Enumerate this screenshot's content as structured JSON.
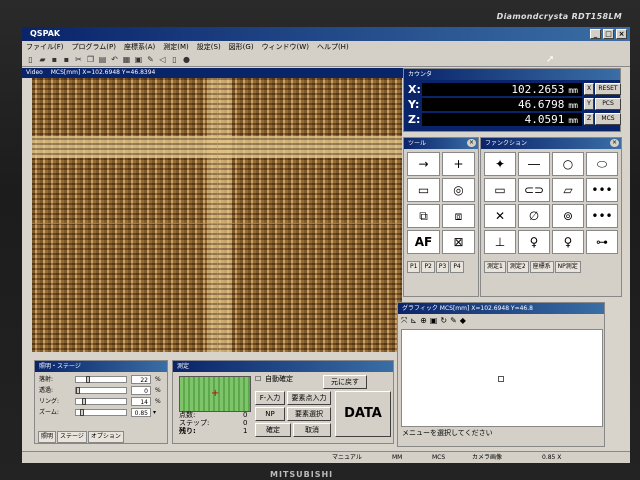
{
  "monitor": {
    "brand": "Diamondcrysta RDT158LM",
    "maker": "MITSUBISHI"
  },
  "app": {
    "title": "QSPAK"
  },
  "window_buttons": [
    "_",
    "□",
    "×"
  ],
  "menu": [
    "ファイル(F)",
    "プログラム(P)",
    "座標系(A)",
    "測定(M)",
    "設定(S)",
    "図形(G)",
    "ウィンドウ(W)",
    "ヘルプ(H)"
  ],
  "video": {
    "label": "Video",
    "coords": "MCS[mm] X=102.6948 Y=46.8394"
  },
  "counter": {
    "title": "カウンタ",
    "x_label": "X:",
    "x_value": "102.2653",
    "x_unit": "mm",
    "y_label": "Y:",
    "y_value": "46.6798",
    "y_unit": "mm",
    "z_label": "Z:",
    "z_value": "4.0591",
    "z_unit": "mm",
    "btn_x": "X",
    "btn_reset": "RESET",
    "btn_y": "Y",
    "btn_pcs": "PCS",
    "btn_z": "Z",
    "btn_mcs": "MCS"
  },
  "tools": {
    "title": "ツール",
    "cells": [
      "→",
      "+",
      "▭",
      "◎",
      "⧉",
      "⧈",
      "AF",
      "⊠"
    ],
    "tabs": [
      "P1",
      "P2",
      "P3",
      "P4"
    ]
  },
  "functions": {
    "title": "ファンクション",
    "cells": [
      "✦",
      "―",
      "○",
      "⬭",
      "▭",
      "⊂⊃",
      "▱",
      "•••",
      "✕",
      "∅",
      "⊚",
      "•••",
      "⊥",
      "♀",
      "♀",
      "⊶"
    ],
    "tabs": [
      "測定1",
      "測定2",
      "座標系",
      "NP測定"
    ]
  },
  "lighting": {
    "title": "照明・ステージ",
    "rows": [
      {
        "label": "落射:",
        "value": "22",
        "unit": "%"
      },
      {
        "label": "透過:",
        "value": "0",
        "unit": "%"
      },
      {
        "label": "リング:",
        "value": "14",
        "unit": "%"
      },
      {
        "label": "ズーム:",
        "value": "0.85",
        "unit": "▾"
      }
    ],
    "tabs": [
      "照明",
      "ステージ",
      "オプション"
    ]
  },
  "measure": {
    "title": "測定",
    "auto_confirm": "自動確定",
    "btn_back": "元に戻す",
    "btn_f": "F-入力",
    "btn_add": "要素点入力",
    "btn_np": "NP",
    "btn_select": "要素選択",
    "btn_data": "DATA",
    "btn_confirm": "確定",
    "btn_cancel": "取消",
    "points_label": "点数:",
    "points_value": "0",
    "step_label": "ステップ:",
    "step_value": "0",
    "remain_label": "残り:",
    "remain_value": "1"
  },
  "listwin": {
    "title": "グラフィック MCS[mm] X=102.6948 Y=46.8",
    "status": "メニューを選択してください"
  },
  "status": {
    "mode": "マニュアル",
    "unit": "MM",
    "cs": "MCS",
    "cam": "カメラ画像",
    "zoom": "0.85 X"
  }
}
